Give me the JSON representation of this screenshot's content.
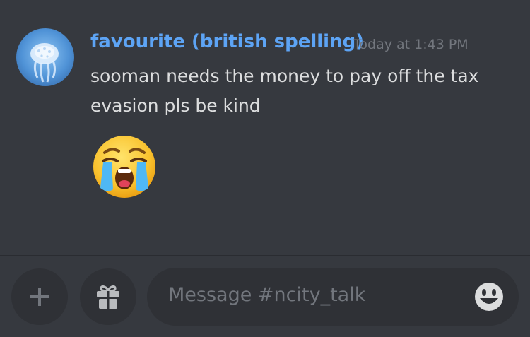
{
  "message": {
    "username": "favourite (british spelling)",
    "timestamp": "Today at 1:43 PM",
    "text": "sooman needs the money to pay off the tax evasion pls be kind",
    "emoji": "loudly-crying-face"
  },
  "composer": {
    "placeholder": "Message #ncity_talk"
  },
  "colors": {
    "background": "#36393f",
    "username": "#5da4f5",
    "timestamp": "#72767d",
    "text": "#dcddde",
    "input": "#2f3136"
  },
  "icons": [
    "avatar-jellyfish",
    "plus-icon",
    "gift-icon",
    "emoji-smiley-icon",
    "loudly-crying-face-emoji"
  ]
}
